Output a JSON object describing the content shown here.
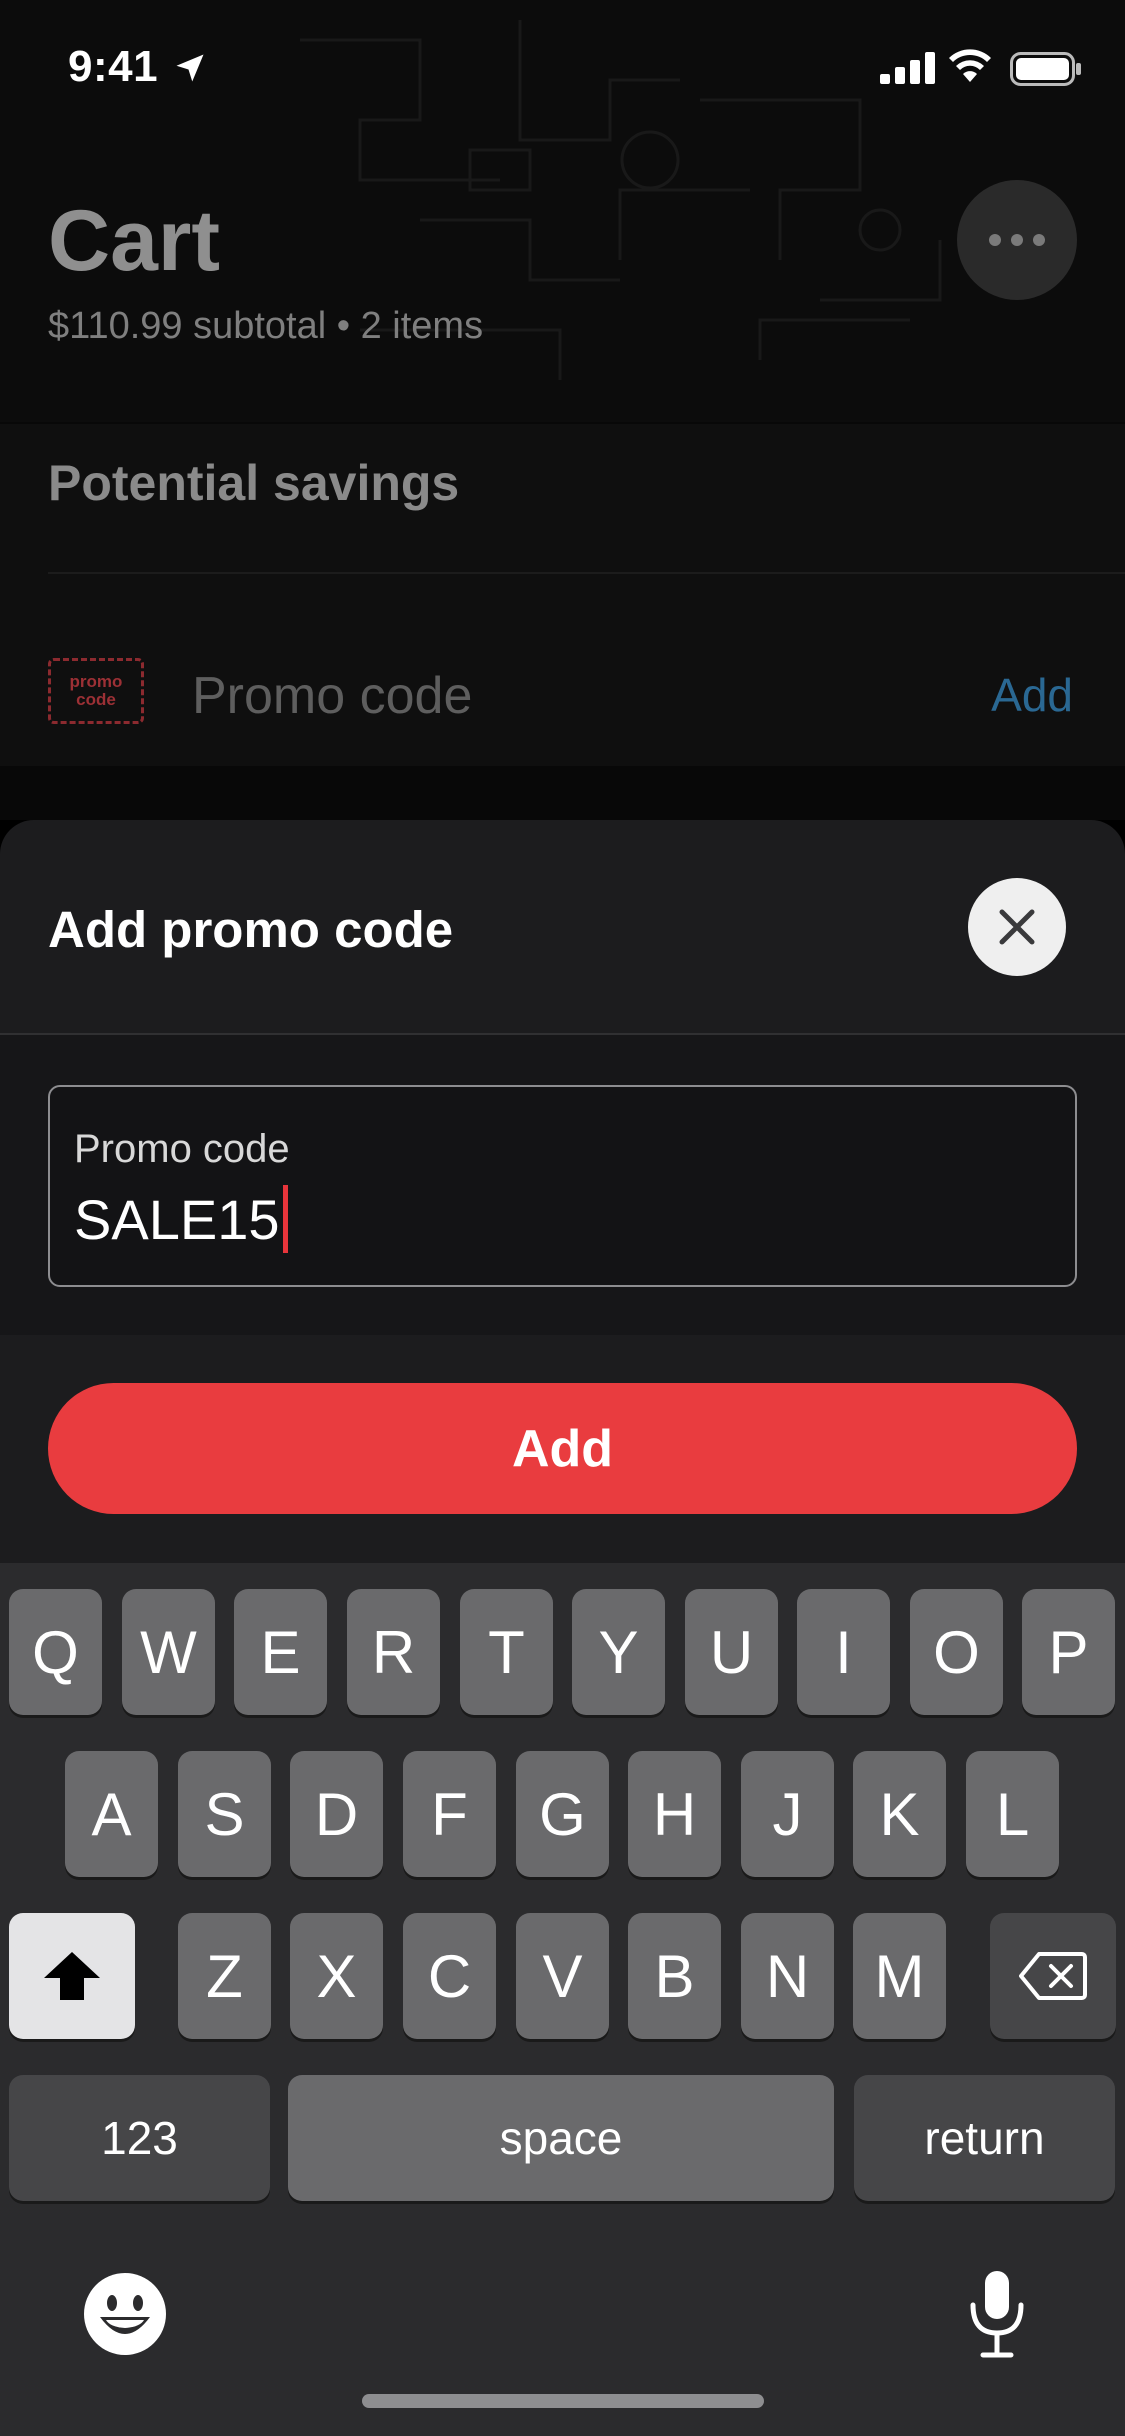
{
  "status_bar": {
    "time": "9:41"
  },
  "cart": {
    "title": "Cart",
    "subtitle": "$110.99 subtotal • 2 items",
    "more_icon": "ellipsis-icon"
  },
  "savings": {
    "title": "Potential savings",
    "promo_badge": "promo code",
    "promo_label": "Promo code",
    "add_link": "Add"
  },
  "sheet": {
    "title": "Add promo code",
    "close_icon": "close-icon",
    "input_label": "Promo code",
    "input_value": "SALE15",
    "add_button": "Add"
  },
  "keyboard": {
    "row1": [
      "Q",
      "W",
      "E",
      "R",
      "T",
      "Y",
      "U",
      "I",
      "O",
      "P"
    ],
    "row2": [
      "A",
      "S",
      "D",
      "F",
      "G",
      "H",
      "J",
      "K",
      "L"
    ],
    "row3": [
      "Z",
      "X",
      "C",
      "V",
      "B",
      "N",
      "M"
    ],
    "numbers_key": "123",
    "space_key": "space",
    "return_key": "return"
  },
  "colors": {
    "accent_red": "#e93c3f",
    "link_blue": "#2a6893",
    "sheet_bg": "#1c1c1e",
    "keyboard_bg": "#2b2b2d"
  }
}
